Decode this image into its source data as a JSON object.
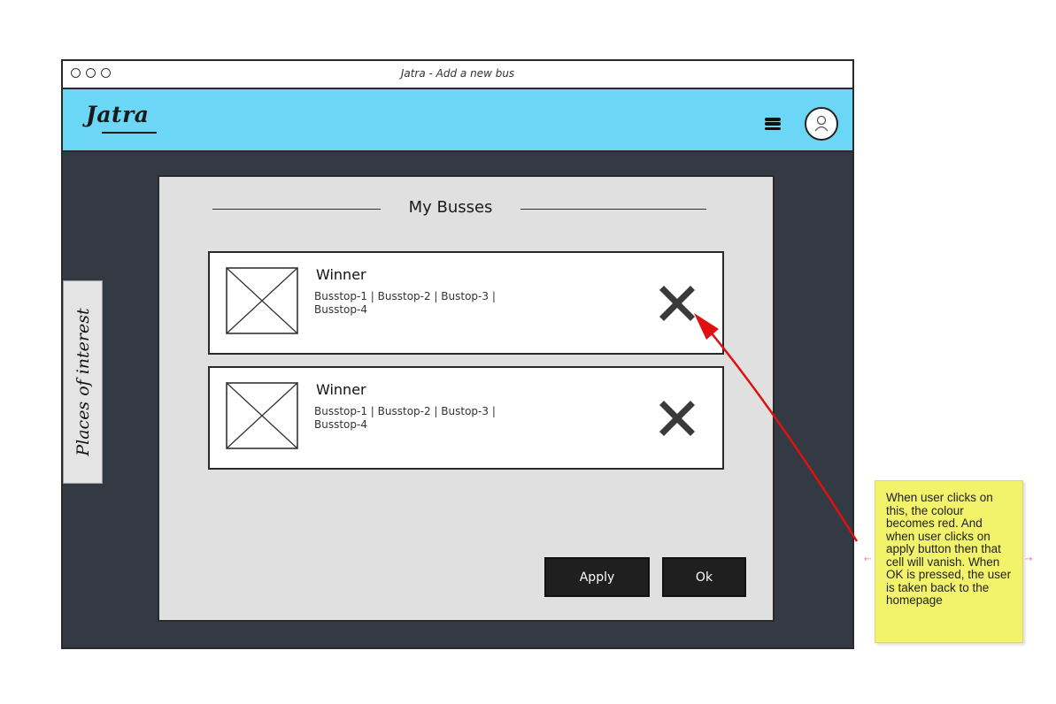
{
  "window": {
    "title": "Jatra - Add a new bus"
  },
  "header": {
    "logo": "Jatra",
    "menu_icon": "hamburger-icon",
    "avatar_icon": "user-avatar-icon"
  },
  "side_tab": {
    "label": "Places of interest"
  },
  "dialog": {
    "title": "My Busses",
    "buses": [
      {
        "name": "Winner",
        "stops": "Busstop-1 | Busstop-2 | Bustop-3 | Busstop-4",
        "remove_icon": "close-x-icon",
        "thumb_icon": "image-placeholder-icon"
      },
      {
        "name": "Winner",
        "stops": "Busstop-1 | Busstop-2 | Bustop-3 | Busstop-4",
        "remove_icon": "close-x-icon",
        "thumb_icon": "image-placeholder-icon"
      }
    ],
    "apply_label": "Apply",
    "ok_label": "Ok"
  },
  "annotation": {
    "text": "When user clicks on this, the colour becomes red. And when user clicks on apply button then that cell will vanish. When OK is pressed, the user is taken back to the homepage"
  },
  "colors": {
    "header_bg": "#6bd6f5",
    "window_bg": "#333a44",
    "dialog_bg": "#e0e0e0",
    "note_bg": "#f2f26b",
    "arrow": "#e01010"
  }
}
